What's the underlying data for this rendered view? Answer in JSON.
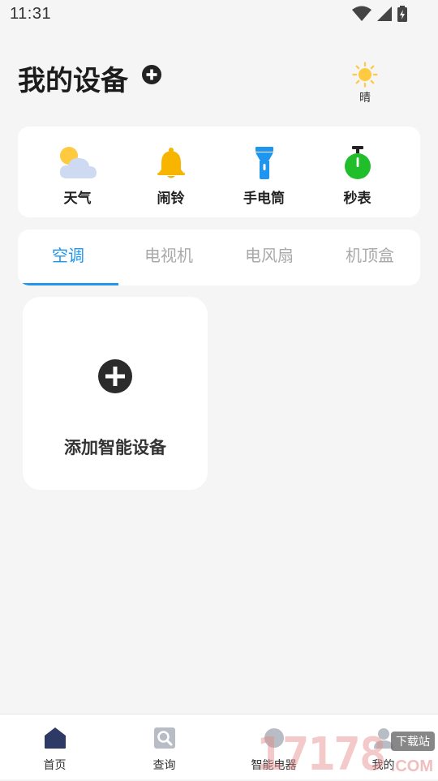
{
  "status_bar": {
    "time": "11:31"
  },
  "header": {
    "title": "我的设备"
  },
  "weather": {
    "condition": "晴"
  },
  "tools": [
    {
      "label": "天气",
      "icon": "weather-cloud-sun-icon"
    },
    {
      "label": "闹铃",
      "icon": "alarm-bell-icon"
    },
    {
      "label": "手电筒",
      "icon": "flashlight-icon"
    },
    {
      "label": "秒表",
      "icon": "stopwatch-icon"
    }
  ],
  "tabs": [
    {
      "label": "空调",
      "active": true
    },
    {
      "label": "电视机",
      "active": false
    },
    {
      "label": "电风扇",
      "active": false
    },
    {
      "label": "机顶盒",
      "active": false
    }
  ],
  "add_card": {
    "label": "添加智能设备"
  },
  "bottom_nav": [
    {
      "label": "首页",
      "icon": "home-icon",
      "active": true
    },
    {
      "label": "查询",
      "icon": "search-icon",
      "active": false
    },
    {
      "label": "智能电器",
      "icon": "appliance-icon",
      "active": false
    },
    {
      "label": "我的",
      "icon": "profile-icon",
      "active": false
    }
  ],
  "watermark": {
    "number": "17178",
    "sub": "下载站",
    "domain": ".COM"
  },
  "colors": {
    "accent": "#1e95ee",
    "bell": "#f7b500",
    "flashlight": "#1e95ee",
    "stopwatch": "#1fbe2a",
    "sun": "#ffc940"
  }
}
